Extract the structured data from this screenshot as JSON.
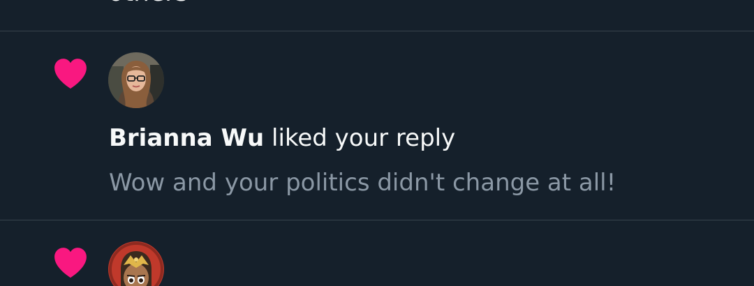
{
  "previous_item": {
    "text_tail": "others"
  },
  "notifications": [
    {
      "type": "like",
      "icon": "heart-icon",
      "actor": "Brianna Wu",
      "action": "liked your reply",
      "snippet": "Wow and your politics didn't change at all!"
    },
    {
      "type": "like",
      "icon": "heart-icon",
      "actor": "",
      "action": "",
      "snippet": ""
    }
  ],
  "colors": {
    "background": "#15202b",
    "heart": "#f91880",
    "divider": "#38444d",
    "primary_text": "#f7f9f9",
    "secondary_text": "#8b98a5"
  }
}
